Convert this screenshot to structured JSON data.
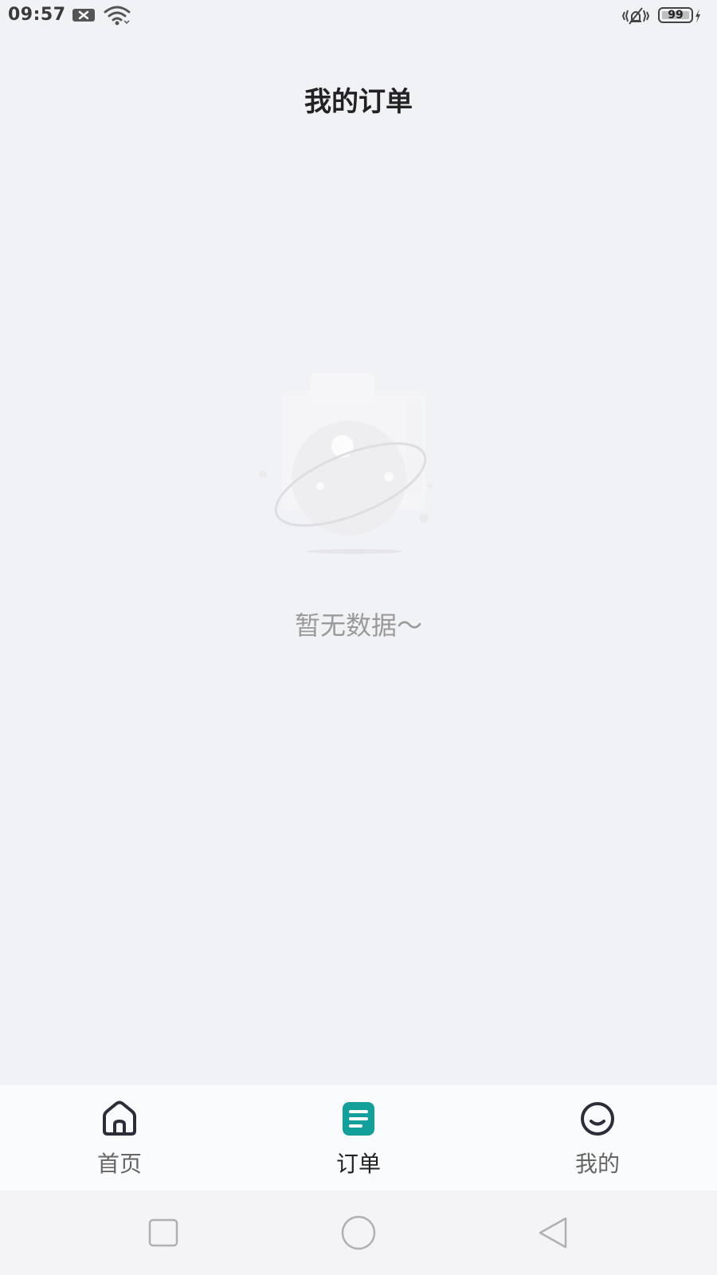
{
  "status_bar": {
    "time": "09:57",
    "battery_level": "99",
    "icons": [
      "notification-x-icon",
      "wifi-icon",
      "vibrate-icon",
      "battery-icon",
      "charging-icon"
    ]
  },
  "header": {
    "title": "我的订单"
  },
  "empty_state": {
    "message": "暂无数据～",
    "illustration": "planet-icon"
  },
  "tab_bar": {
    "active_color": "#14a09a",
    "items": [
      {
        "label": "首页",
        "icon": "home-icon",
        "active": false
      },
      {
        "label": "订单",
        "icon": "order-list-icon",
        "active": true
      },
      {
        "label": "我的",
        "icon": "smile-icon",
        "active": false
      }
    ]
  },
  "nav_bar": {
    "buttons": [
      "recent-apps-icon",
      "home-circle-icon",
      "back-triangle-icon"
    ]
  }
}
